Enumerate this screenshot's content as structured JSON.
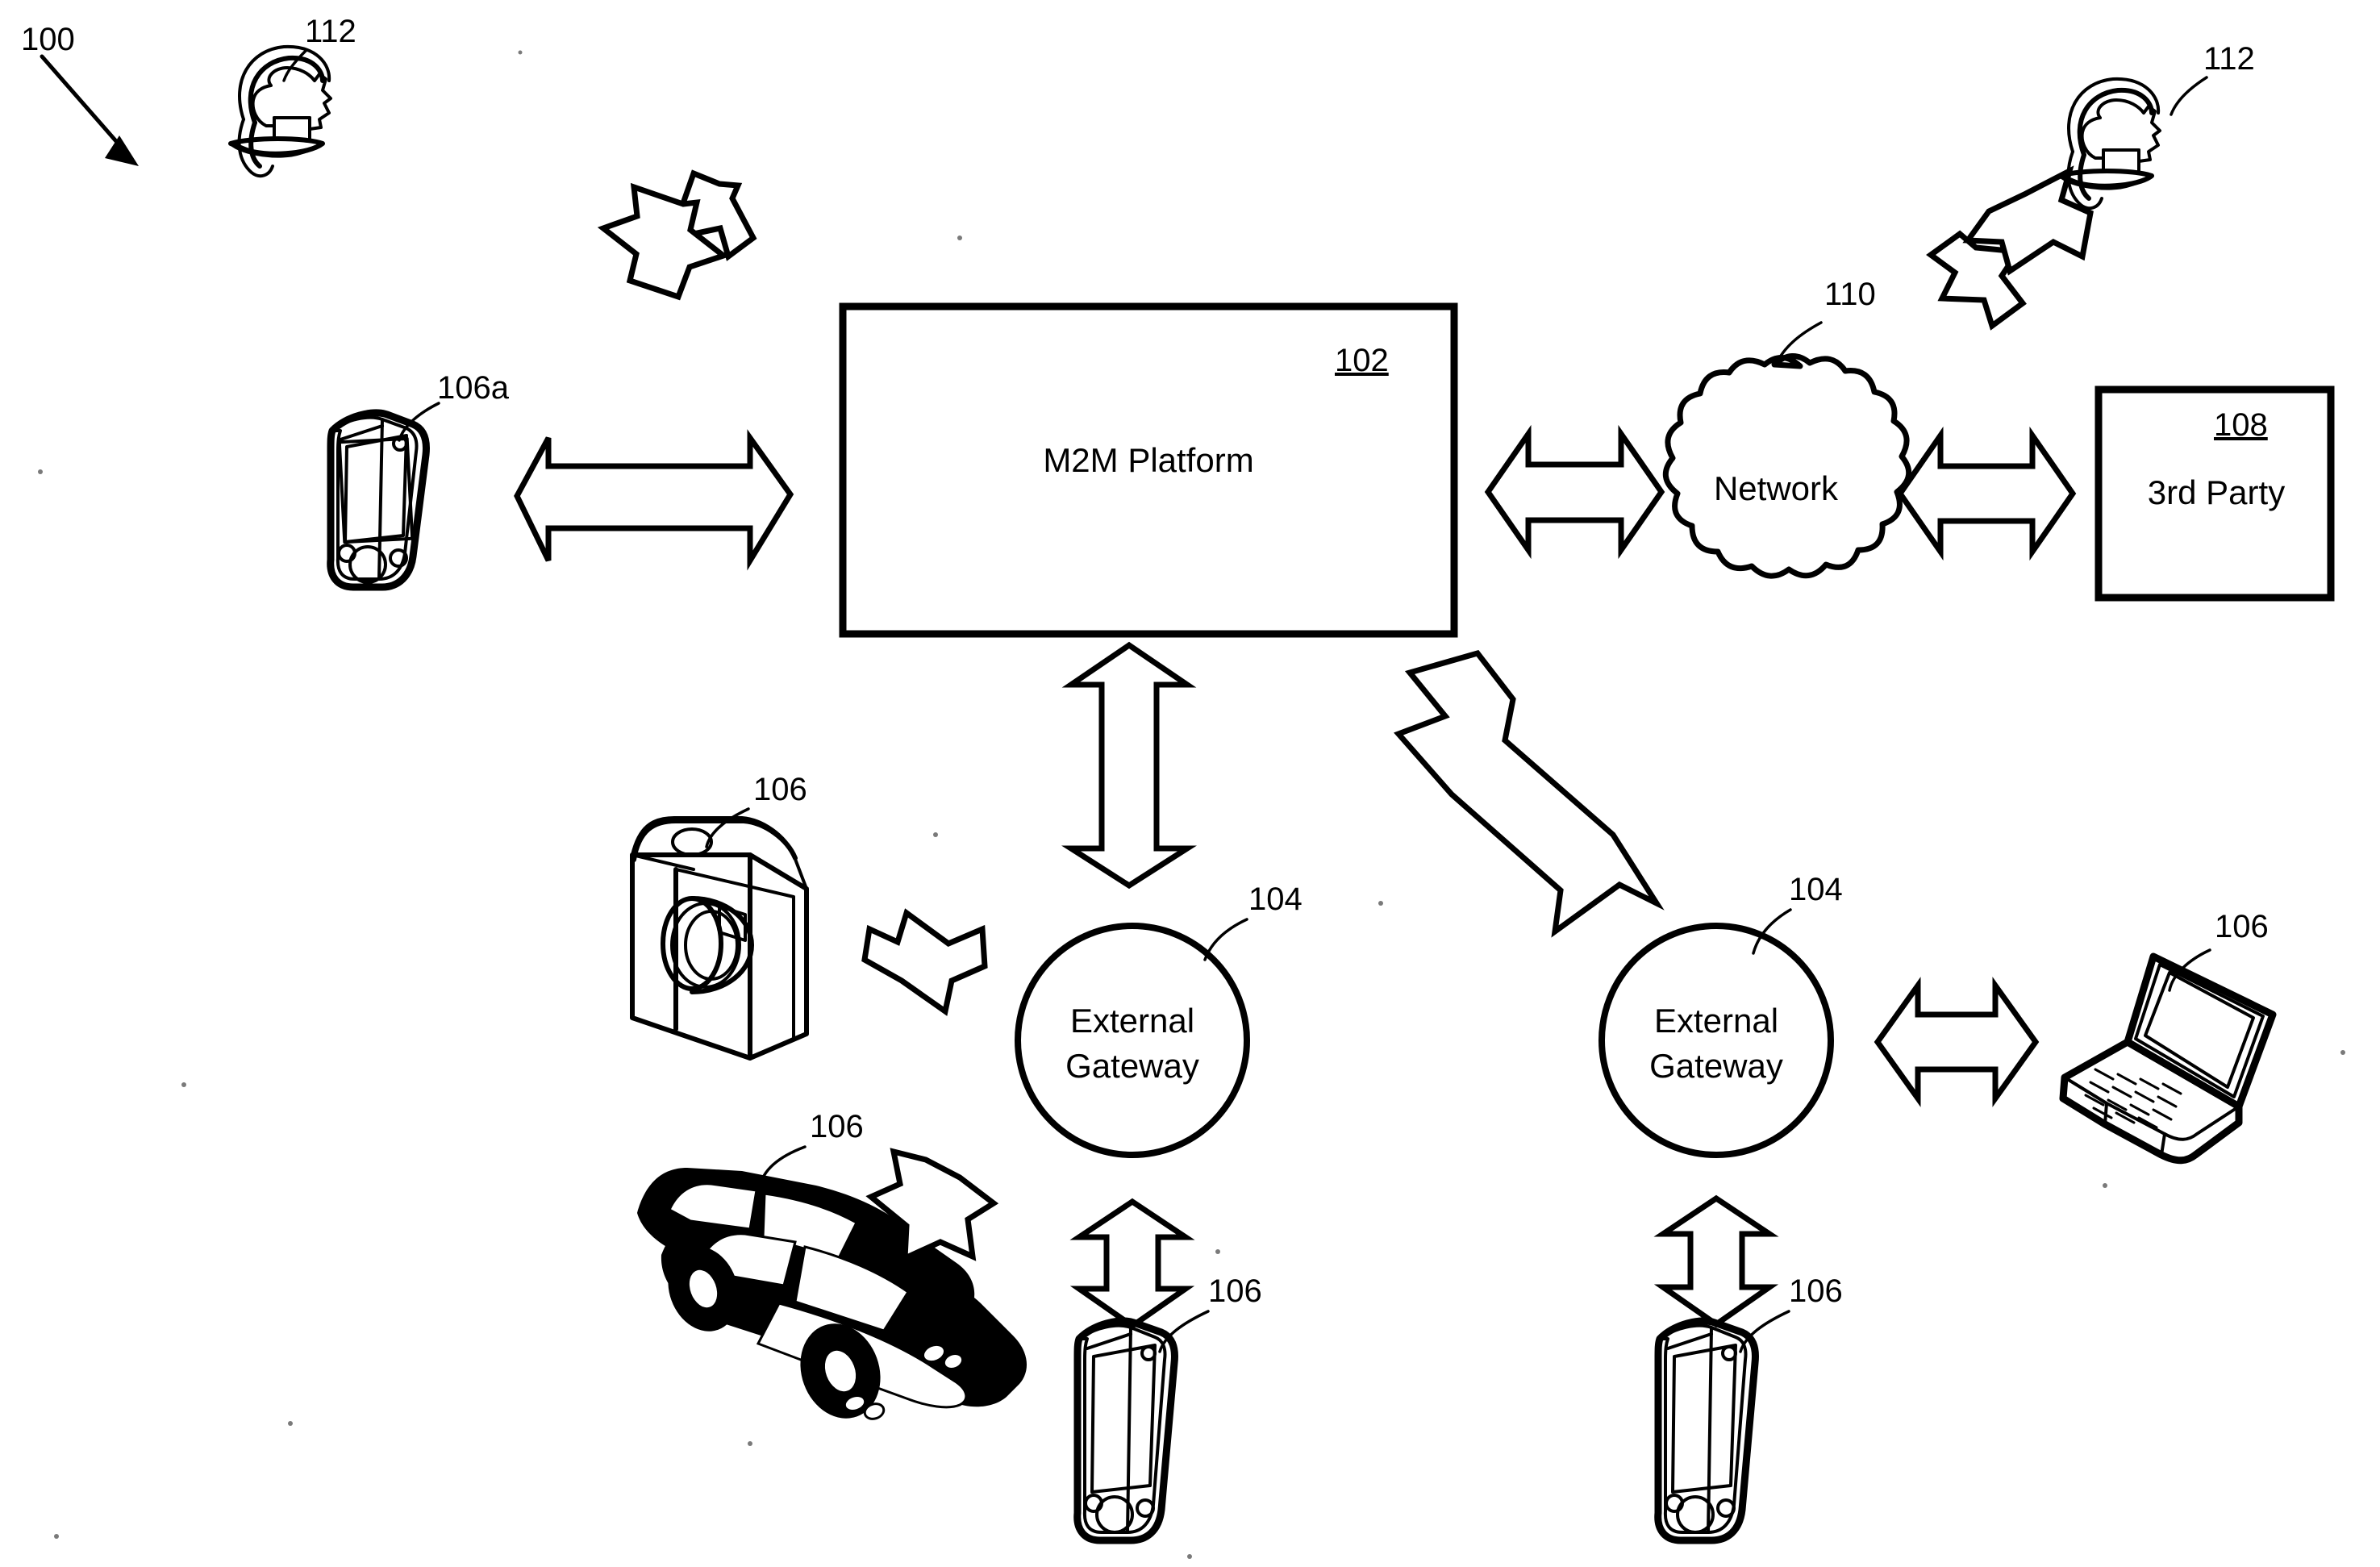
{
  "figure": {
    "figure_number": "100",
    "nodes": {
      "platform": {
        "label": "M2M Platform",
        "ref": "102"
      },
      "network": {
        "label": "Network",
        "ref": "110"
      },
      "third_party": {
        "label": "3rd Party",
        "ref": "108"
      },
      "gateway_left": {
        "label_line1": "External",
        "label_line2": "Gateway",
        "ref": "104"
      },
      "gateway_right": {
        "label_line1": "External",
        "label_line2": "Gateway",
        "ref": "104"
      }
    },
    "device_refs": {
      "user_top_left": "112",
      "user_top_right": "112",
      "pda_left": "106a",
      "camera": "106",
      "car": "106",
      "phone_center_bottom": "106",
      "phone_right_bottom": "106",
      "laptop": "106"
    },
    "colors": {
      "line": "#000000",
      "fill": "#ffffff"
    }
  }
}
